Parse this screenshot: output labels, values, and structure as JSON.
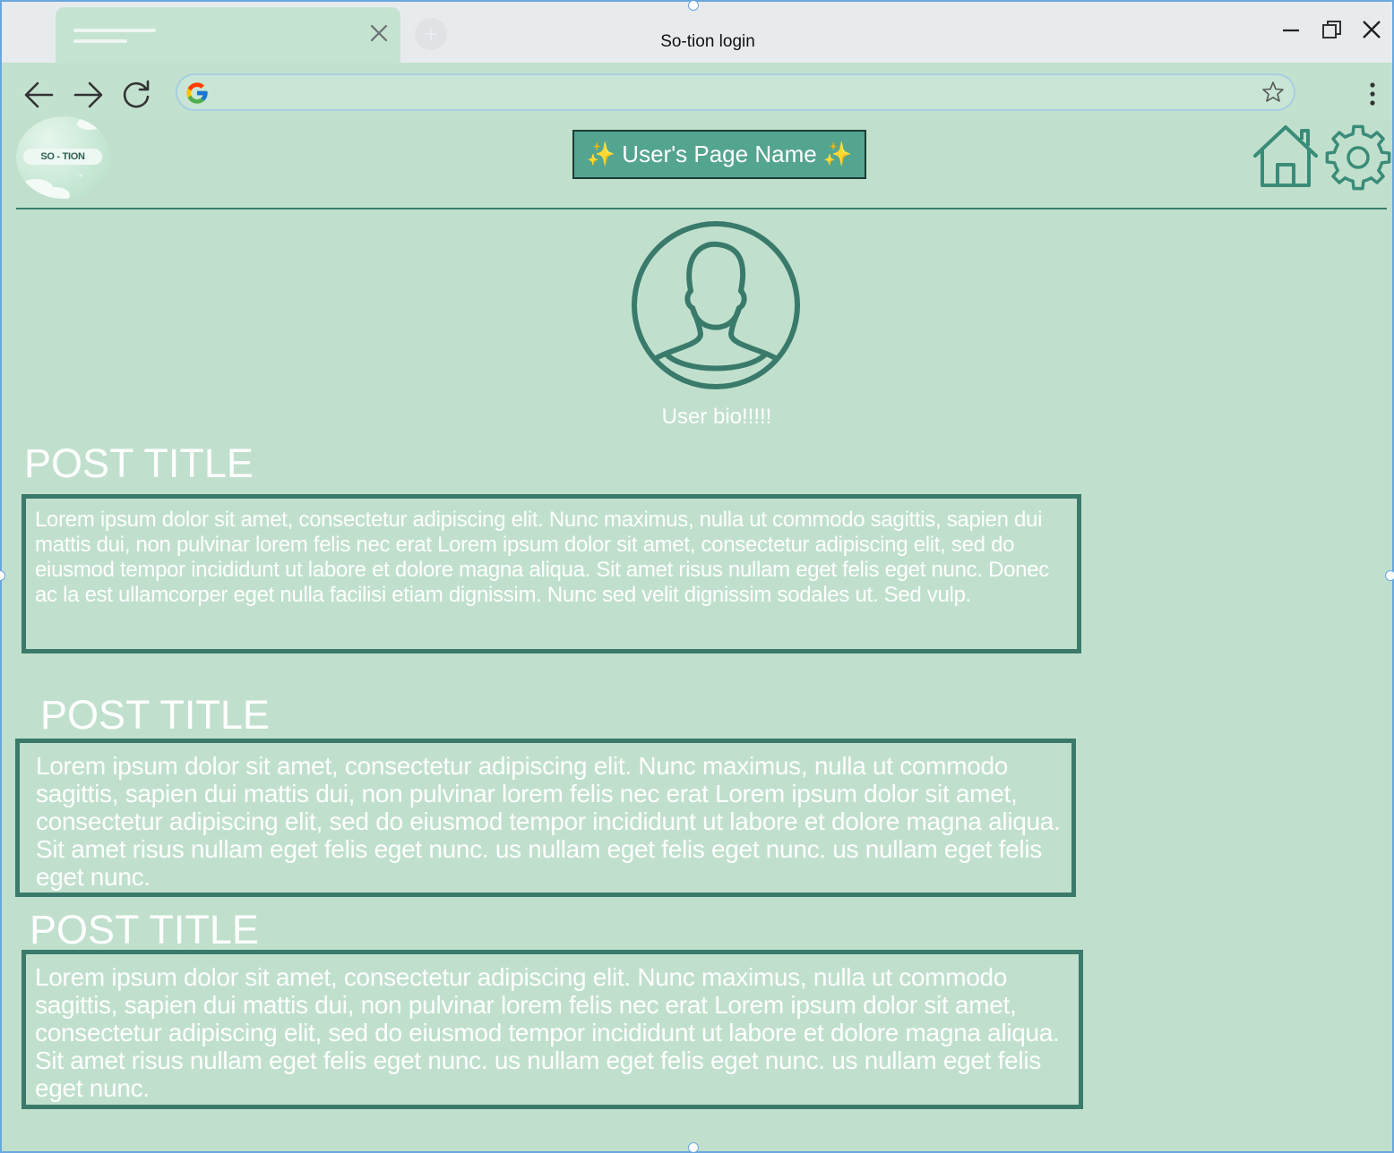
{
  "window": {
    "title": "So-tion login"
  },
  "browser": {
    "address_value": ""
  },
  "header": {
    "logo_text": "SO - TION",
    "page_name": "✨ User's Page Name ✨"
  },
  "profile": {
    "bio": "User bio!!!!!"
  },
  "posts": [
    {
      "title": "POST TITLE",
      "body": "Lorem ipsum dolor sit amet, consectetur adipiscing elit. Nunc maximus, nulla ut commodo sagittis, sapien dui mattis dui, non pulvinar lorem felis nec erat Lorem ipsum dolor sit amet, consectetur adipiscing elit, sed do eiusmod tempor incididunt ut labore et dolore magna aliqua. Sit amet risus nullam eget felis eget nunc. Donec ac la est ullamcorper eget nulla facilisi etiam dignissim. Nunc sed velit dignissim sodales ut. Sed vulp."
    },
    {
      "title": "POST TITLE",
      "body": "Lorem ipsum dolor sit amet, consectetur adipiscing elit. Nunc maximus, nulla ut commodo sagittis, sapien dui mattis dui, non pulvinar lorem felis nec erat Lorem ipsum dolor sit amet, consectetur adipiscing elit, sed do eiusmod tempor incididunt ut labore et dolore magna aliqua. Sit amet risus nullam eget felis eget nunc. us nullam eget felis eget nunc. us nullam eget felis eget nunc."
    },
    {
      "title": "POST TITLE",
      "body": "Lorem ipsum dolor sit amet, consectetur adipiscing elit. Nunc maximus, nulla ut commodo sagittis, sapien dui mattis dui, non pulvinar lorem felis nec erat Lorem ipsum dolor sit amet, consectetur adipiscing elit, sed do eiusmod tempor incididunt ut labore et dolore magna aliqua. Sit amet risus nullam eget felis eget nunc. us nullam eget felis eget nunc. us nullam eget felis eget nunc."
    }
  ],
  "icons": {
    "tab_close": "close-icon",
    "new_tab": "plus-icon",
    "minimize": "minimize-icon",
    "restore": "restore-icon",
    "close": "close-icon",
    "back": "arrow-left-icon",
    "forward": "arrow-right-icon",
    "reload": "reload-icon",
    "search_engine": "google-icon",
    "bookmark": "star-icon",
    "menu": "more-vertical-icon",
    "home": "home-icon",
    "settings": "gear-icon",
    "avatar": "user-icon"
  },
  "colors": {
    "page_background": "#c0e0cd",
    "accent_dark": "#3b7a6a",
    "page_name_fill": "#54a590",
    "text": "#ffffff"
  }
}
